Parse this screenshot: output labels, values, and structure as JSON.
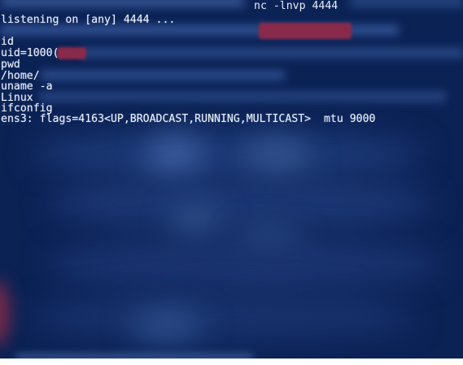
{
  "terminal": {
    "command": "nc -lnvp 4444",
    "lines": [
      "listening on [any] 4444 ...",
      "id",
      "uid=1000(",
      "pwd",
      "/home/",
      "uname -a",
      "Linux",
      "ifconfig",
      "ens3: flags=4163<UP,BROADCAST,RUNNING,MULTICAST>  mtu 9000"
    ]
  },
  "colors": {
    "background": "#0b2255",
    "text": "#e8eef8",
    "redaction": "#8a2a4a"
  }
}
